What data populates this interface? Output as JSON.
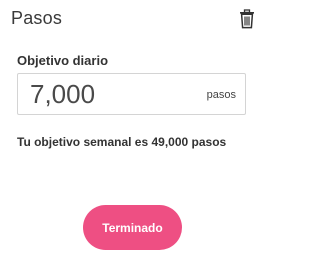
{
  "header": {
    "title": "Pasos",
    "delete_icon": "trash-icon"
  },
  "goal": {
    "label": "Objetivo diario",
    "value": "7,000",
    "unit": "pasos"
  },
  "weekly_goal_text": "Tu objetivo semanal es 49,000 pasos",
  "done_button": {
    "label": "Terminado",
    "color": "#ee4f83"
  }
}
